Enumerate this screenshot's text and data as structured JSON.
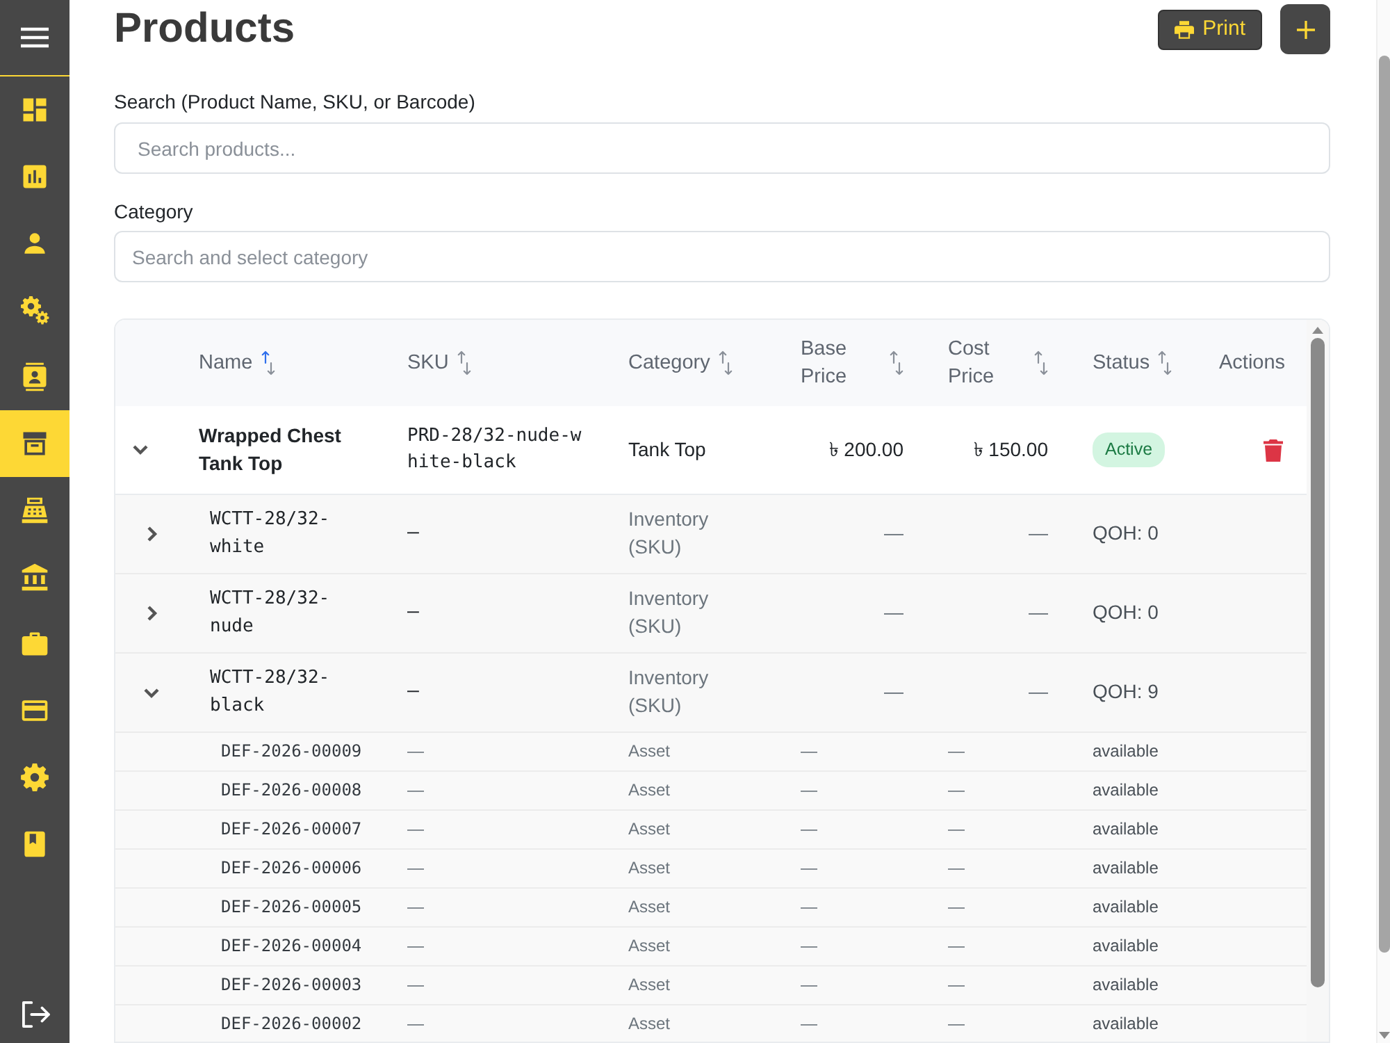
{
  "sidebar": {
    "items": [
      {
        "kind": "dashboard",
        "selected": false
      },
      {
        "kind": "chart",
        "selected": false
      },
      {
        "kind": "person",
        "selected": false
      },
      {
        "kind": "gears",
        "selected": false
      },
      {
        "kind": "contact",
        "selected": false
      },
      {
        "kind": "archive",
        "selected": true
      },
      {
        "kind": "register",
        "selected": false
      },
      {
        "kind": "bank",
        "selected": false
      },
      {
        "kind": "briefcase",
        "selected": false
      },
      {
        "kind": "card",
        "selected": false
      },
      {
        "kind": "gear",
        "selected": false
      },
      {
        "kind": "book",
        "selected": false
      }
    ]
  },
  "header": {
    "title": "Products",
    "print_label": "Print"
  },
  "filters": [
    {
      "label": "Search (Product Name, SKU, or Barcode)",
      "placeholder": "Search products..."
    },
    {
      "label": "Category",
      "placeholder": "Search and select category"
    }
  ],
  "table": {
    "columns": [
      {
        "label": "Name",
        "sortable": true,
        "sorted": true
      },
      {
        "label": "SKU",
        "sortable": true,
        "sorted": false
      },
      {
        "label": "Category",
        "sortable": true,
        "sorted": false
      },
      {
        "label": "Base Price",
        "sortable": true,
        "sorted": false
      },
      {
        "label": "Cost Price",
        "sortable": true,
        "sorted": false
      },
      {
        "label": "Status",
        "sortable": true,
        "sorted": false
      },
      {
        "label": "Actions",
        "sortable": false
      }
    ],
    "rows": [
      {
        "kind": "product",
        "expanded": true,
        "name": "Wrapped Chest Tank Top",
        "sku": "PRD-28/32-nude-white-black",
        "category": "Tank Top",
        "base_price": "৳ 200.00",
        "cost_price": "৳ 150.00",
        "status": "Active",
        "children": [
          {
            "kind": "variant",
            "expanded": false,
            "name": "WCTT-28/32-white",
            "sku": "—",
            "category": "Inventory (SKU)",
            "base_price": "—",
            "cost_price": "—",
            "status": "QOH: 0"
          },
          {
            "kind": "variant",
            "expanded": false,
            "name": "WCTT-28/32-nude",
            "sku": "—",
            "category": "Inventory (SKU)",
            "base_price": "—",
            "cost_price": "—",
            "status": "QOH: 0"
          },
          {
            "kind": "variant",
            "expanded": true,
            "name": "WCTT-28/32-black",
            "sku": "—",
            "category": "Inventory (SKU)",
            "base_price": "—",
            "cost_price": "—",
            "status": "QOH: 9",
            "children": [
              {
                "kind": "asset",
                "name": "DEF-2026-00009",
                "sku": "—",
                "category": "Asset",
                "base_price": "—",
                "cost_price": "—",
                "status": "available"
              },
              {
                "kind": "asset",
                "name": "DEF-2026-00008",
                "sku": "—",
                "category": "Asset",
                "base_price": "—",
                "cost_price": "—",
                "status": "available"
              },
              {
                "kind": "asset",
                "name": "DEF-2026-00007",
                "sku": "—",
                "category": "Asset",
                "base_price": "—",
                "cost_price": "—",
                "status": "available"
              },
              {
                "kind": "asset",
                "name": "DEF-2026-00006",
                "sku": "—",
                "category": "Asset",
                "base_price": "—",
                "cost_price": "—",
                "status": "available"
              },
              {
                "kind": "asset",
                "name": "DEF-2026-00005",
                "sku": "—",
                "category": "Asset",
                "base_price": "—",
                "cost_price": "—",
                "status": "available"
              },
              {
                "kind": "asset",
                "name": "DEF-2026-00004",
                "sku": "—",
                "category": "Asset",
                "base_price": "—",
                "cost_price": "—",
                "status": "available"
              },
              {
                "kind": "asset",
                "name": "DEF-2026-00003",
                "sku": "—",
                "category": "Asset",
                "base_price": "—",
                "cost_price": "—",
                "status": "available"
              },
              {
                "kind": "asset",
                "name": "DEF-2026-00002",
                "sku": "—",
                "category": "Asset",
                "base_price": "—",
                "cost_price": "—",
                "status": "available"
              }
            ]
          }
        ]
      }
    ]
  }
}
